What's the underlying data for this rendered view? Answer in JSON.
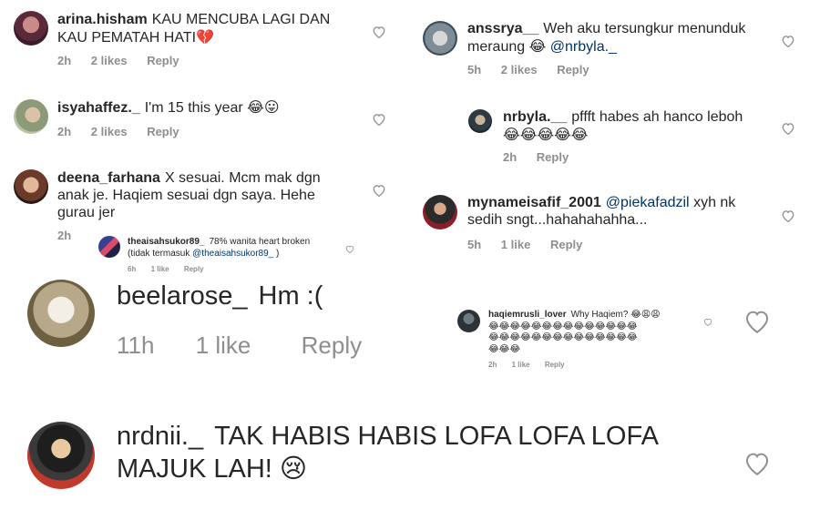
{
  "comments": [
    {
      "user": "arina.hisham",
      "text": "KAU MENCUBA LAGI DAN KAU PEMATAH HATI",
      "emoji": "💔",
      "time": "2h",
      "likes": "2 likes",
      "reply": "Reply"
    },
    {
      "user": "isyahaffez._",
      "text": "I'm 15 this year",
      "emoji": "😂😛",
      "time": "2h",
      "likes": "2 likes",
      "reply": "Reply"
    },
    {
      "user": "deena_farhana",
      "text": "X sesuai. Mcm mak dgn anak je. Haqiem sesuai dgn saya. Hehe gurau jer",
      "time": "2h"
    },
    {
      "user": "theaisahsukor89_",
      "text": "78% wanita heart broken (tidak termasuk",
      "mention": "@theaisahsukor89_",
      "text_after": ")",
      "time": "6h",
      "likes": "1 like",
      "reply": "Reply"
    },
    {
      "user": "beelarose_",
      "text": "Hm :(",
      "time": "11h",
      "likes": "1 like",
      "reply": "Reply"
    },
    {
      "user": "nrdnii._",
      "text": "TAK HABIS HABIS LOFA LOFA LOFA MAJUK LAH!",
      "emoji": "😢"
    },
    {
      "user": "anssrya__",
      "text": "Weh aku tersungkur menunduk meraung",
      "emoji": "😂",
      "mention": "@nrbyla._",
      "time": "5h",
      "likes": "2 likes",
      "reply": "Reply"
    },
    {
      "user": "nrbyla.__",
      "text": "pffft habes ah hanco leboh",
      "emoji": "😂😂😂😂😂",
      "time": "2h",
      "reply": "Reply"
    },
    {
      "user": "mynameisafif_2001",
      "mention": "@piekafadzil",
      "text": "xyh nk sedih sngt...hahahahahha...",
      "time": "5h",
      "likes": "1 like",
      "reply": "Reply"
    },
    {
      "user": "haqiemrusli_lover",
      "text": "Why Haqiem?",
      "emoji": "😂😩😩",
      "emoji_rows": [
        "😂😂😂😂😂😂😂😂😂😂😂😂😂😂",
        "😂😂😂😂😂😂😂😂😂😂😂😂😂😂",
        "😂😂😂"
      ],
      "time": "2h",
      "likes": "1 like",
      "reply": "Reply"
    }
  ],
  "colors": {
    "text": "#262626",
    "meta": "#8e8e8e",
    "mention": "#003569",
    "heart": "#8e8e8e"
  },
  "icons": {
    "heart": "heart-icon"
  }
}
